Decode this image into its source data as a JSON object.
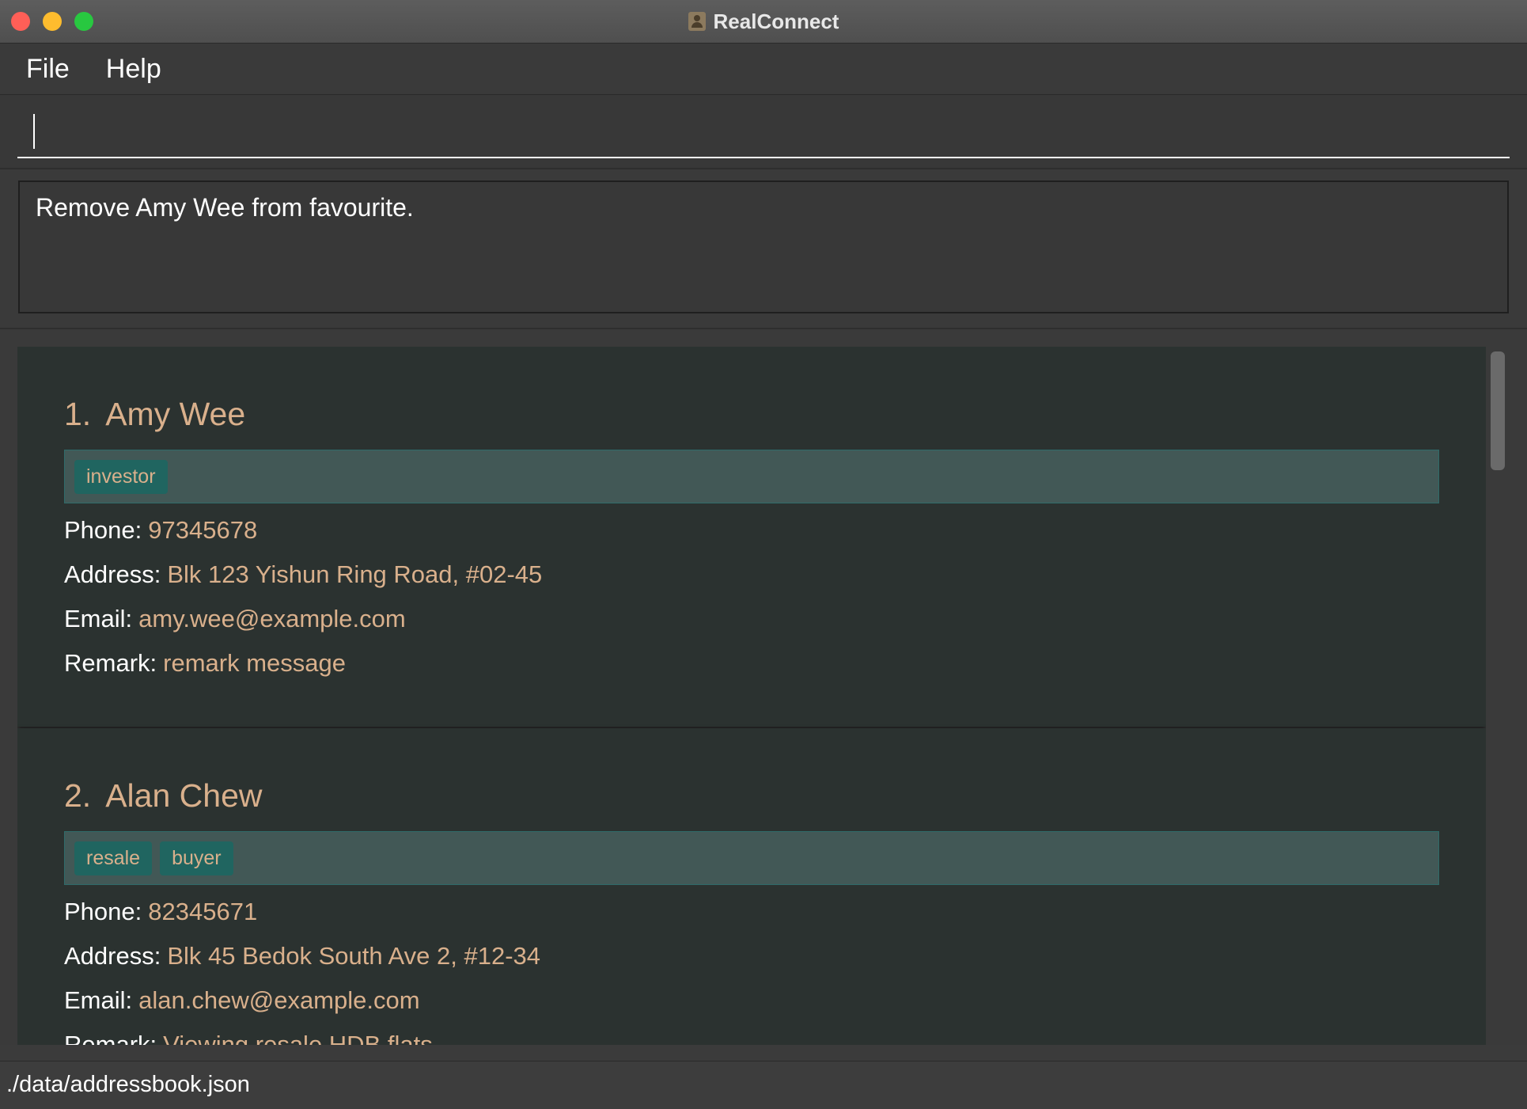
{
  "window": {
    "title": "RealConnect"
  },
  "menu": {
    "items": [
      "File",
      "Help"
    ]
  },
  "command": {
    "value": "",
    "placeholder": ""
  },
  "result": {
    "message": "Remove Amy Wee from favourite."
  },
  "persons": [
    {
      "index": "1.",
      "name": "Amy Wee",
      "tags": [
        "investor"
      ],
      "phone_label": "Phone:",
      "phone": "97345678",
      "address_label": "Address:",
      "address": "Blk 123 Yishun Ring Road, #02-45",
      "email_label": "Email:",
      "email": "amy.wee@example.com",
      "remark_label": "Remark:",
      "remark": "remark message"
    },
    {
      "index": "2.",
      "name": "Alan Chew",
      "tags": [
        "resale",
        "buyer"
      ],
      "phone_label": "Phone:",
      "phone": "82345671",
      "address_label": "Address:",
      "address": "Blk 45 Bedok South Ave 2, #12-34",
      "email_label": "Email:",
      "email": "alan.chew@example.com",
      "remark_label": "Remark:",
      "remark": "Viewing resale HDB flats"
    }
  ],
  "status": {
    "file_path": "./data/addressbook.json"
  },
  "colors": {
    "accent": "#d9b08c",
    "tag_bg": "#206560",
    "card_bg": "#2b3230",
    "tag_strip": "#425856"
  },
  "icons": [
    "close-button",
    "minimize-button",
    "maximize-button",
    "app-icon"
  ]
}
